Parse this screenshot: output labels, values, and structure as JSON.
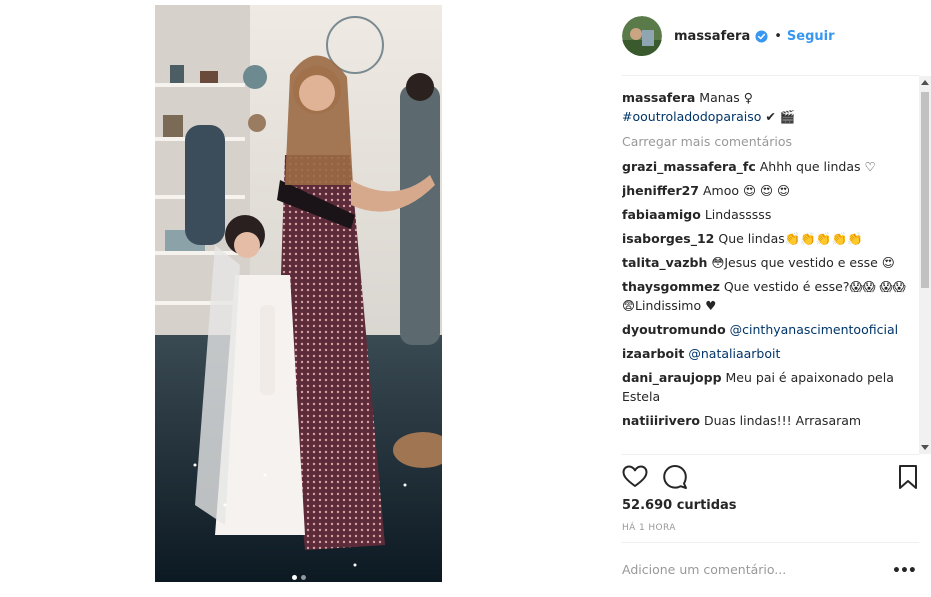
{
  "post": {
    "username": "massafera",
    "follow_label": "Seguir",
    "separator": "•",
    "caption_text": "Manas ♀",
    "caption_hashtag": "#ooutroladodoparaiso",
    "caption_emoji": "✔ 🎬",
    "load_more": "Carregar mais comentários",
    "likes": "52.690 curtidas",
    "time": "HÁ 1 HORA",
    "add_comment_placeholder": "Adicione um comentário...",
    "more_options": "•••",
    "carousel": {
      "count": 2,
      "active": 1
    }
  },
  "comments": [
    {
      "user": "grazi_massafera_fc",
      "text": "Ahhh que lindas ♡"
    },
    {
      "user": "jheniffer27",
      "text": "Amoo 😍 😍 😍"
    },
    {
      "user": "fabiaamigo",
      "text": "Lindasssss"
    },
    {
      "user": "isaborges_12",
      "text": "Que lindas👏👏👏👏👏"
    },
    {
      "user": "talita_vazbh",
      "text": "😳Jesus que vestido e esse 😍"
    },
    {
      "user": "thaysgommez",
      "text": "Que vestido é esse?😱😱 😱😱😨Lindissimo ♥"
    },
    {
      "user": "dyoutromundo",
      "mention": "@cinthyanascimentooficial"
    },
    {
      "user": "izaarboit",
      "mention": "@nataliaarboit"
    },
    {
      "user": "dani_araujopp",
      "text": "Meu pai é apaixonado pela Estela"
    },
    {
      "user": "natiiirivero",
      "text": "Duas lindas!!! Arrasaram"
    }
  ],
  "icons": {
    "like": "heart-icon",
    "comment": "comment-bubble-icon",
    "save": "bookmark-icon",
    "verified": "verified-badge-icon"
  },
  "colors": {
    "link_blue": "#3897f0",
    "hashtag_blue": "#003569",
    "muted": "#999999",
    "text": "#262626"
  }
}
